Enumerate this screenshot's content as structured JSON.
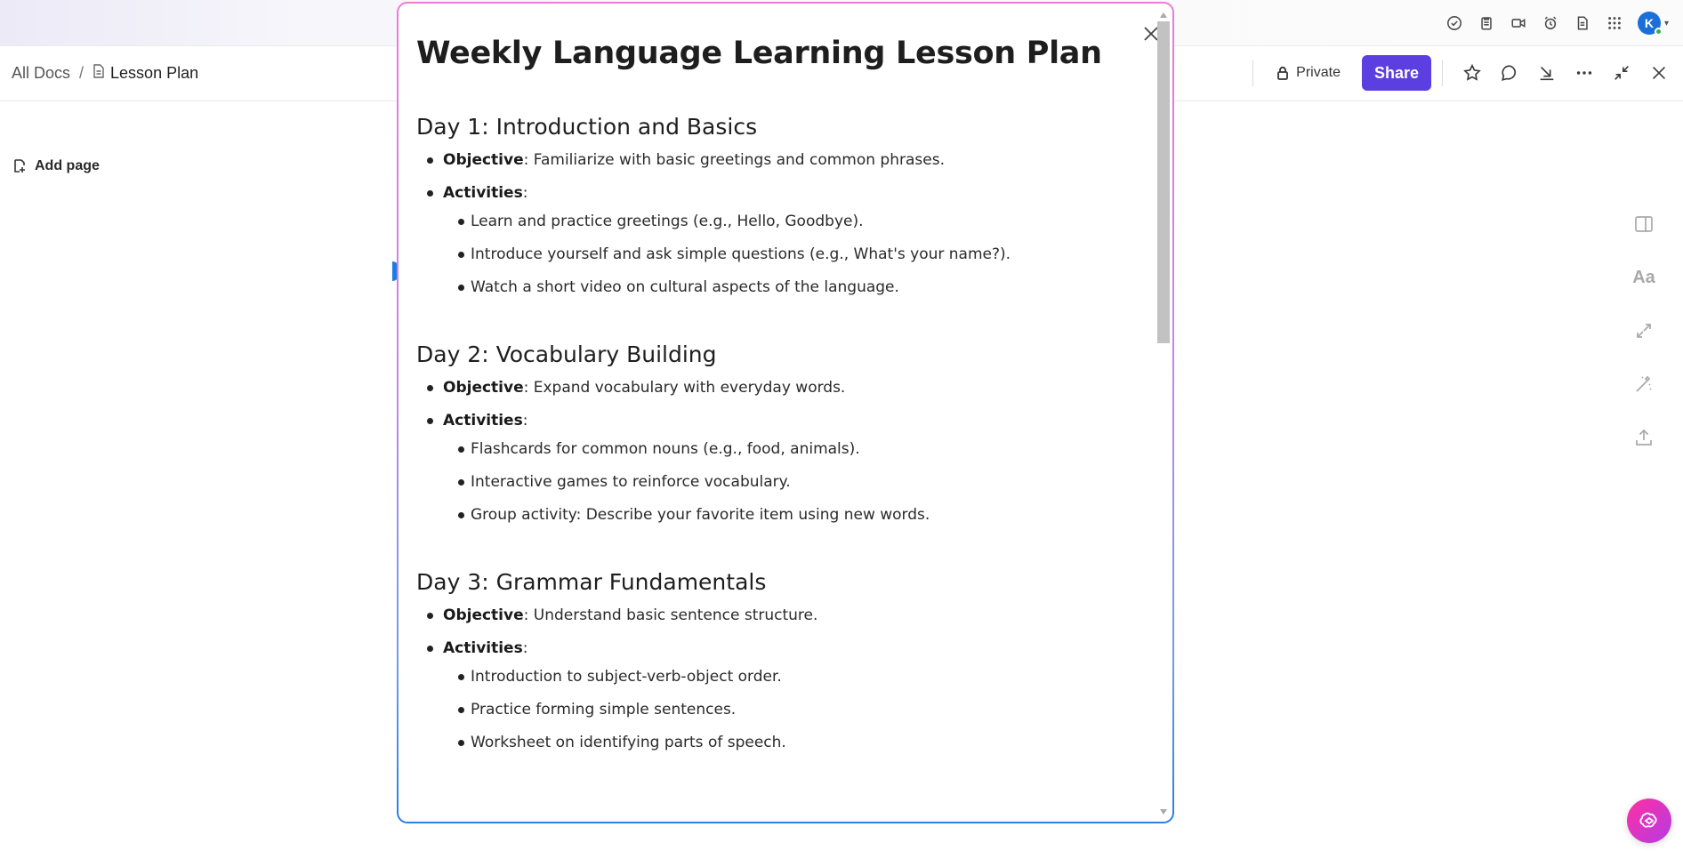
{
  "breadcrumb": {
    "root": "All Docs",
    "separator": "/",
    "current": "Lesson Plan"
  },
  "header": {
    "private_label": "Private",
    "share_label": "Share"
  },
  "sidebar": {
    "add_page_label": "Add page"
  },
  "user": {
    "avatar_initial": "K"
  },
  "rail": {
    "font_label": "Aa"
  },
  "colors": {
    "accent": "#5b3fe0",
    "avatar": "#1b6fd8",
    "online": "#2cb34a"
  },
  "modal": {
    "title": "Weekly Language Learning Lesson Plan",
    "objective_label": "Objective",
    "activities_label": "Activities",
    "days": [
      {
        "heading": "Day 1: Introduction and Basics",
        "objective": ": Familiarize with basic greetings and common phrases.",
        "activities_suffix": ":",
        "activities": [
          "Learn and practice greetings (e.g., Hello, Goodbye).",
          "Introduce yourself and ask simple questions (e.g., What's your name?).",
          "Watch a short video on cultural aspects of the language."
        ]
      },
      {
        "heading": "Day 2: Vocabulary Building",
        "objective": ": Expand vocabulary with everyday words.",
        "activities_suffix": ":",
        "activities": [
          "Flashcards for common nouns (e.g., food, animals).",
          "Interactive games to reinforce vocabulary.",
          "Group activity: Describe your favorite item using new words."
        ]
      },
      {
        "heading": "Day 3: Grammar Fundamentals",
        "objective": ": Understand basic sentence structure.",
        "activities_suffix": ":",
        "activities": [
          "Introduction to subject-verb-object order.",
          "Practice forming simple sentences.",
          "Worksheet on identifying parts of speech."
        ]
      }
    ]
  }
}
